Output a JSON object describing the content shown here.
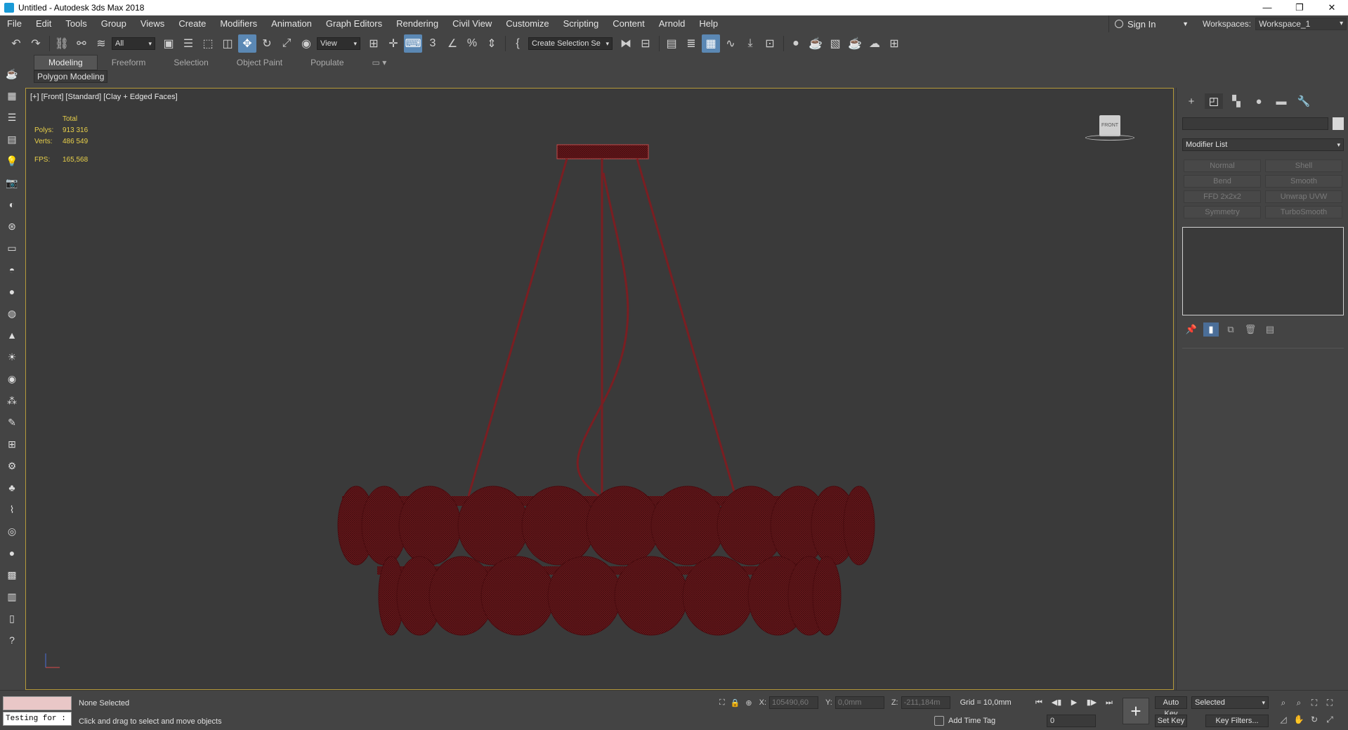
{
  "window": {
    "title": "Untitled - Autodesk 3ds Max 2018",
    "minimize": "—",
    "restore": "❐",
    "close": "✕"
  },
  "menu": {
    "items": [
      "File",
      "Edit",
      "Tools",
      "Group",
      "Views",
      "Create",
      "Modifiers",
      "Animation",
      "Graph Editors",
      "Rendering",
      "Civil View",
      "Customize",
      "Scripting",
      "Content",
      "Arnold",
      "Help"
    ],
    "sign_in": "Sign In",
    "workspaces_label": "Workspaces:",
    "workspace_value": "Workspace_1"
  },
  "toolbar": {
    "filter_value": "All",
    "refcoord_value": "View",
    "selection_set_value": "Create Selection Se"
  },
  "ribbon": {
    "tabs": [
      "Modeling",
      "Freeform",
      "Selection",
      "Object Paint",
      "Populate"
    ],
    "active_tab": "Modeling",
    "sub_label": "Polygon Modeling"
  },
  "viewport": {
    "label": "[+] [Front] [Standard] [Clay + Edged Faces]",
    "stats": {
      "total_label": "Total",
      "polys_label": "Polys:",
      "polys_value": "913 316",
      "verts_label": "Verts:",
      "verts_value": "486 549",
      "fps_label": "FPS:",
      "fps_value": "165,568"
    },
    "viewcube_label": "FRONT",
    "colors": {
      "border": "#b59a3a",
      "stats": "#e8d04a",
      "mesh": "#7a1e22"
    }
  },
  "command_panel": {
    "modifier_list": "Modifier List",
    "modifier_buttons": [
      "Normal",
      "Shell",
      "Bend",
      "Smooth",
      "FFD 2x2x2",
      "Unwrap UVW",
      "Symmetry",
      "TurboSmooth"
    ]
  },
  "status": {
    "listener_text": "Testing for :",
    "selection_status": "None Selected",
    "prompt": "Click and drag to select and move objects",
    "x_label": "X:",
    "x_value": "105490,60",
    "y_label": "Y:",
    "y_value": "0,0mm",
    "z_label": "Z:",
    "z_value": "-211,184m",
    "grid": "Grid = 10,0mm",
    "add_time_tag": "Add Time Tag",
    "frame_value": "0",
    "auto_key": "Auto Key",
    "set_key": "Set Key",
    "selected_value": "Selected",
    "key_filters": "Key Filters..."
  }
}
